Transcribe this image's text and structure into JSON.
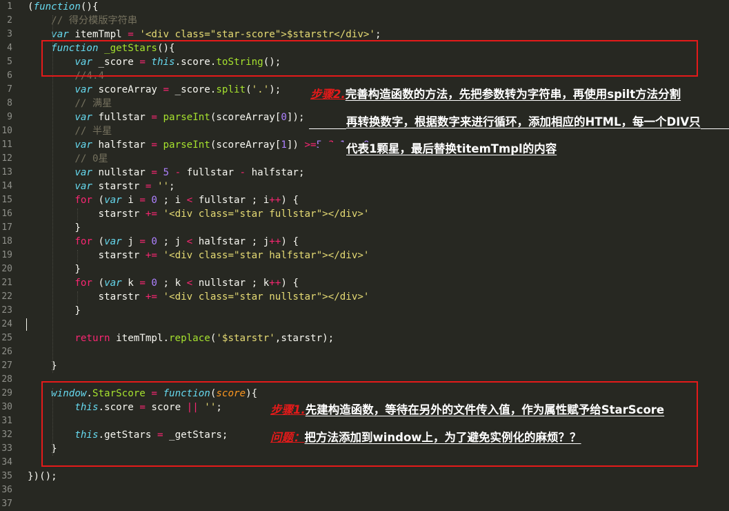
{
  "editor": {
    "lines": [
      {
        "n": "1",
        "tokens": [
          [
            "p",
            "("
          ],
          [
            "kw",
            "function"
          ],
          [
            "p",
            "(){"
          ]
        ]
      },
      {
        "n": "2",
        "tokens": [
          [
            "p",
            "    "
          ],
          [
            "cm",
            "// 得分模版字符串"
          ]
        ]
      },
      {
        "n": "3",
        "tokens": [
          [
            "p",
            "    "
          ],
          [
            "kw",
            "var"
          ],
          [
            "p",
            " itemTmpl "
          ],
          [
            "red",
            "="
          ],
          [
            "p",
            " "
          ],
          [
            "str",
            "'<div class=\"star-score\">$starstr</div>'"
          ],
          [
            "p",
            ";"
          ]
        ]
      },
      {
        "n": "4",
        "tokens": [
          [
            "p",
            "    "
          ],
          [
            "kw",
            "function"
          ],
          [
            "p",
            " "
          ],
          [
            "ent",
            "_getStars"
          ],
          [
            "p",
            "(){"
          ]
        ]
      },
      {
        "n": "5",
        "tokens": [
          [
            "p",
            "        "
          ],
          [
            "kw",
            "var"
          ],
          [
            "p",
            " _score "
          ],
          [
            "red",
            "="
          ],
          [
            "p",
            " "
          ],
          [
            "kw",
            "this"
          ],
          [
            "p",
            ".score."
          ],
          [
            "prop",
            "toString"
          ],
          [
            "p",
            "();"
          ]
        ]
      },
      {
        "n": "6",
        "tokens": [
          [
            "p",
            "        "
          ],
          [
            "cm",
            "//4.4"
          ]
        ]
      },
      {
        "n": "7",
        "tokens": [
          [
            "p",
            "        "
          ],
          [
            "kw",
            "var"
          ],
          [
            "p",
            " scoreArray "
          ],
          [
            "red",
            "="
          ],
          [
            "p",
            " _score."
          ],
          [
            "prop",
            "split"
          ],
          [
            "p",
            "("
          ],
          [
            "str",
            "'.'"
          ],
          [
            "p",
            ");"
          ]
        ]
      },
      {
        "n": "8",
        "tokens": [
          [
            "p",
            "        "
          ],
          [
            "cm",
            "// 满星"
          ]
        ]
      },
      {
        "n": "9",
        "tokens": [
          [
            "p",
            "        "
          ],
          [
            "kw",
            "var"
          ],
          [
            "p",
            " fullstar "
          ],
          [
            "red",
            "="
          ],
          [
            "p",
            " "
          ],
          [
            "prop",
            "parseInt"
          ],
          [
            "p",
            "(scoreArray["
          ],
          [
            "num",
            "0"
          ],
          [
            "p",
            "]);"
          ]
        ]
      },
      {
        "n": "10",
        "tokens": [
          [
            "p",
            "        "
          ],
          [
            "cm",
            "// 半星"
          ]
        ]
      },
      {
        "n": "11",
        "tokens": [
          [
            "p",
            "        "
          ],
          [
            "kw",
            "var"
          ],
          [
            "p",
            " halfstar "
          ],
          [
            "red",
            "="
          ],
          [
            "p",
            " "
          ],
          [
            "prop",
            "parseInt"
          ],
          [
            "p",
            "(scoreArray["
          ],
          [
            "num",
            "1"
          ],
          [
            "p",
            "]) "
          ],
          [
            "red",
            ">="
          ],
          [
            "num",
            "5"
          ],
          [
            "p",
            " "
          ],
          [
            "red",
            "?"
          ],
          [
            "p",
            " "
          ],
          [
            "num",
            "1"
          ],
          [
            "p",
            " : "
          ],
          [
            "num",
            "0"
          ],
          [
            "p",
            ";"
          ]
        ]
      },
      {
        "n": "12",
        "tokens": [
          [
            "p",
            "        "
          ],
          [
            "cm",
            "// 0星"
          ]
        ]
      },
      {
        "n": "13",
        "tokens": [
          [
            "p",
            "        "
          ],
          [
            "kw",
            "var"
          ],
          [
            "p",
            " nullstar "
          ],
          [
            "red",
            "="
          ],
          [
            "p",
            " "
          ],
          [
            "num",
            "5"
          ],
          [
            "p",
            " "
          ],
          [
            "red",
            "-"
          ],
          [
            "p",
            " fullstar "
          ],
          [
            "red",
            "-"
          ],
          [
            "p",
            " halfstar;"
          ]
        ]
      },
      {
        "n": "14",
        "tokens": [
          [
            "p",
            "        "
          ],
          [
            "kw",
            "var"
          ],
          [
            "p",
            " starstr "
          ],
          [
            "red",
            "="
          ],
          [
            "p",
            " "
          ],
          [
            "str",
            "''"
          ],
          [
            "p",
            ";"
          ]
        ]
      },
      {
        "n": "15",
        "tokens": [
          [
            "p",
            "        "
          ],
          [
            "red",
            "for"
          ],
          [
            "p",
            " ("
          ],
          [
            "kw",
            "var"
          ],
          [
            "p",
            " i "
          ],
          [
            "red",
            "="
          ],
          [
            "p",
            " "
          ],
          [
            "num",
            "0"
          ],
          [
            "p",
            " ; i "
          ],
          [
            "red",
            "<"
          ],
          [
            "p",
            " fullstar ; i"
          ],
          [
            "red",
            "++"
          ],
          [
            "p",
            ") {"
          ]
        ]
      },
      {
        "n": "16",
        "tokens": [
          [
            "p",
            "            starstr "
          ],
          [
            "red",
            "+="
          ],
          [
            "p",
            " "
          ],
          [
            "str",
            "'<div class=\"star fullstar\"></div>'"
          ]
        ]
      },
      {
        "n": "17",
        "tokens": [
          [
            "p",
            "        }"
          ]
        ]
      },
      {
        "n": "18",
        "tokens": [
          [
            "p",
            "        "
          ],
          [
            "red",
            "for"
          ],
          [
            "p",
            " ("
          ],
          [
            "kw",
            "var"
          ],
          [
            "p",
            " j "
          ],
          [
            "red",
            "="
          ],
          [
            "p",
            " "
          ],
          [
            "num",
            "0"
          ],
          [
            "p",
            " ; j "
          ],
          [
            "red",
            "<"
          ],
          [
            "p",
            " halfstar ; j"
          ],
          [
            "red",
            "++"
          ],
          [
            "p",
            ") {"
          ]
        ]
      },
      {
        "n": "19",
        "tokens": [
          [
            "p",
            "            starstr "
          ],
          [
            "red",
            "+="
          ],
          [
            "p",
            " "
          ],
          [
            "str",
            "'<div class=\"star halfstar\"></div>'"
          ]
        ]
      },
      {
        "n": "20",
        "tokens": [
          [
            "p",
            "        }"
          ]
        ]
      },
      {
        "n": "21",
        "tokens": [
          [
            "p",
            "        "
          ],
          [
            "red",
            "for"
          ],
          [
            "p",
            " ("
          ],
          [
            "kw",
            "var"
          ],
          [
            "p",
            " k "
          ],
          [
            "red",
            "="
          ],
          [
            "p",
            " "
          ],
          [
            "num",
            "0"
          ],
          [
            "p",
            " ; k "
          ],
          [
            "red",
            "<"
          ],
          [
            "p",
            " nullstar ; k"
          ],
          [
            "red",
            "++"
          ],
          [
            "p",
            ") {"
          ]
        ]
      },
      {
        "n": "22",
        "tokens": [
          [
            "p",
            "            starstr "
          ],
          [
            "red",
            "+="
          ],
          [
            "p",
            " "
          ],
          [
            "str",
            "'<div class=\"star nullstar\"></div>'"
          ]
        ]
      },
      {
        "n": "23",
        "tokens": [
          [
            "p",
            "        }"
          ]
        ]
      },
      {
        "n": "24",
        "tokens": []
      },
      {
        "n": "25",
        "tokens": [
          [
            "p",
            "        "
          ],
          [
            "red",
            "return"
          ],
          [
            "p",
            " itemTmpl."
          ],
          [
            "prop",
            "replace"
          ],
          [
            "p",
            "("
          ],
          [
            "str",
            "'$starstr'"
          ],
          [
            "p",
            ",starstr);"
          ]
        ]
      },
      {
        "n": "26",
        "tokens": []
      },
      {
        "n": "27",
        "tokens": [
          [
            "p",
            "    }"
          ]
        ]
      },
      {
        "n": "28",
        "tokens": []
      },
      {
        "n": "29",
        "tokens": [
          [
            "p",
            "    "
          ],
          [
            "fn",
            "window"
          ],
          [
            "p",
            "."
          ],
          [
            "prop",
            "StarScore"
          ],
          [
            "p",
            " "
          ],
          [
            "red",
            "="
          ],
          [
            "p",
            " "
          ],
          [
            "kw",
            "function"
          ],
          [
            "p",
            "("
          ],
          [
            "prm",
            "score"
          ],
          [
            "p",
            "){"
          ]
        ]
      },
      {
        "n": "30",
        "tokens": [
          [
            "p",
            "        "
          ],
          [
            "kw",
            "this"
          ],
          [
            "p",
            ".score "
          ],
          [
            "red",
            "="
          ],
          [
            "p",
            " score "
          ],
          [
            "red",
            "||"
          ],
          [
            "p",
            " "
          ],
          [
            "str",
            "''"
          ],
          [
            "p",
            ";"
          ]
        ]
      },
      {
        "n": "31",
        "tokens": []
      },
      {
        "n": "32",
        "tokens": [
          [
            "p",
            "        "
          ],
          [
            "kw",
            "this"
          ],
          [
            "p",
            ".getStars "
          ],
          [
            "red",
            "="
          ],
          [
            "p",
            " _getStars;"
          ]
        ]
      },
      {
        "n": "33",
        "tokens": [
          [
            "p",
            "    }"
          ]
        ]
      },
      {
        "n": "34",
        "tokens": []
      },
      {
        "n": "35",
        "tokens": [
          [
            "p",
            "})();"
          ]
        ]
      },
      {
        "n": "36",
        "tokens": []
      },
      {
        "n": "37",
        "tokens": []
      }
    ]
  },
  "annotations": {
    "step2": {
      "label": "步骤2.",
      "line1": "完善构造函数的方法，先把参数转为字符串，再使用spilt方法分割",
      "line2": "再转换数字，根据数字来进行循环，添加相应的HTML，每一个DIV只",
      "line3": "代表1颗星，最后替换titemTmpl的内容"
    },
    "step1": {
      "label": "步骤1.",
      "text": "先建构造函数，等待在另外的文件传入值，作为属性赋予给StarScore"
    },
    "question": {
      "label": "问题：",
      "text": "把方法添加到window上，为了避免实例化的麻烦？？"
    }
  },
  "colors": {
    "background": "#272822",
    "keyword": "#66d9ef",
    "operator": "#f92672",
    "string": "#e6db74",
    "number": "#ae81ff",
    "comment": "#75715e",
    "function_name": "#a6e22e",
    "annotation_box": "#e51a1a"
  }
}
